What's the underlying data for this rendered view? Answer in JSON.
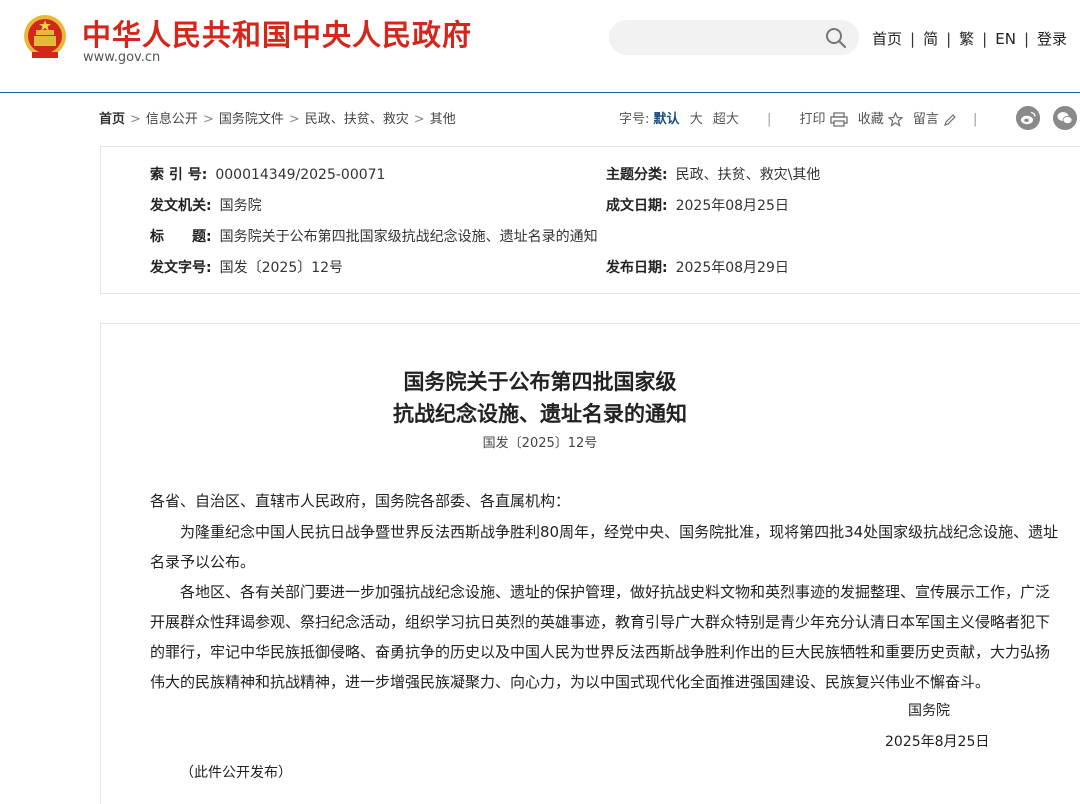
{
  "header": {
    "site_title": "中华人民共和国中央人民政府",
    "site_domain": "www.gov.cn",
    "search": {
      "placeholder": ""
    },
    "nav": [
      "首页",
      "简",
      "繁",
      "EN",
      "登录"
    ]
  },
  "breadcrumb": [
    "首页",
    "信息公开",
    "国务院文件",
    "民政、扶贫、救灾",
    "其他"
  ],
  "toolbar": {
    "font_size_label": "字号:",
    "font_default": "默认",
    "font_large": "大",
    "font_xlarge": "超大",
    "print": "打印",
    "favorite": "收藏",
    "comment": "留言"
  },
  "info": {
    "index_label": "索 引 号:",
    "index_value": "000014349/2025-00071",
    "topic_label": "主题分类:",
    "topic_value": "民政、扶贫、救灾\\其他",
    "issuer_label": "发文机关:",
    "issuer_value": "国务院",
    "written_label": "成文日期:",
    "written_value": "2025年08月25日",
    "title_label": "标　　题:",
    "title_value": "国务院关于公布第四批国家级抗战纪念设施、遗址名录的通知",
    "docnum_label": "发文字号:",
    "docnum_value": "国发〔2025〕12号",
    "published_label": "发布日期:",
    "published_value": "2025年08月29日"
  },
  "article": {
    "title_line1": "国务院关于公布第四批国家级",
    "title_line2": "抗战纪念设施、遗址名录的通知",
    "doc_number": "国发〔2025〕12号",
    "salutation": "各省、自治区、直辖市人民政府，国务院各部委、各直属机构：",
    "para1": "为隆重纪念中国人民抗日战争暨世界反法西斯战争胜利80周年，经党中央、国务院批准，现将第四批34处国家级抗战纪念设施、遗址名录予以公布。",
    "para2": "各地区、各有关部门要进一步加强抗战纪念设施、遗址的保护管理，做好抗战史料文物和英烈事迹的发掘整理、宣传展示工作，广泛开展群众性拜谒参观、祭扫纪念活动，组织学习抗日英烈的英雄事迹，教育引导广大群众特别是青少年充分认清日本军国主义侵略者犯下的罪行，牢记中华民族抵御侵略、奋勇抗争的历史以及中国人民为世界反法西斯战争胜利作出的巨大民族牺牲和重要历史贡献，大力弘扬伟大的民族精神和抗战精神，进一步增强民族凝聚力、向心力，为以中国式现代化全面推进强国建设、民族复兴伟业不懈奋斗。",
    "signature": "国务院",
    "sign_date": "2025年8月25日",
    "note": "（此件公开发布）"
  },
  "colors": {
    "brand_red": "#d5261b",
    "link_blue": "#1a4f8b"
  },
  "icons": [
    "national-emblem-icon",
    "search-icon",
    "print-icon",
    "star-icon",
    "pencil-icon",
    "weibo-icon",
    "wechat-icon"
  ]
}
